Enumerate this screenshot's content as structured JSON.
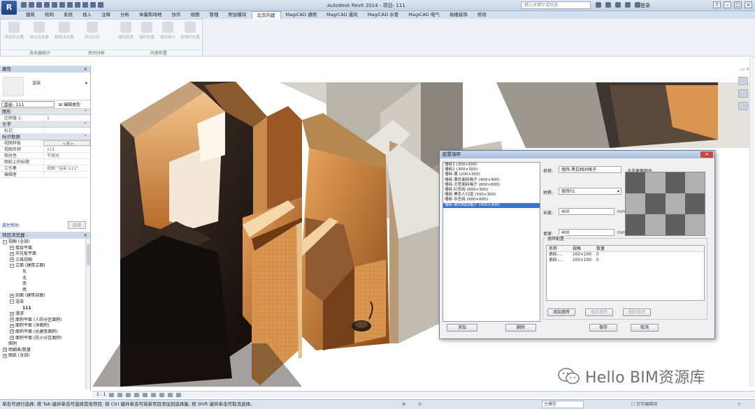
{
  "window": {
    "app_letter": "R",
    "title": "Autodesk Revit 2014 -    项目- 111",
    "search_placeholder": "键入关键字或短语",
    "login": "登录"
  },
  "ribbon": {
    "tabs": [
      "建筑",
      "结构",
      "系统",
      "插入",
      "注释",
      "分析",
      "体量和场地",
      "协作",
      "视图",
      "管理",
      "附加模块",
      "北京内建",
      "MagiCAD 通用",
      "MagiCAD 通风",
      "MagiCAD 水管",
      "MagiCAD 电气",
      "易楼装饰",
      "修改"
    ],
    "active_tab_index": 11,
    "buttons": [
      "添加洗水器",
      "弹出洗水器",
      "删除洗水器",
      "房间分析",
      "墙材厚度",
      "墙材布置",
      "墙材统计",
      "新墙材布置"
    ],
    "groups": [
      "洗水器统计",
      "房间分析",
      "内墙布置"
    ]
  },
  "properties": {
    "header": "属性",
    "type_name": "渲染",
    "selector_value": "渲染: 111",
    "edit_type": "编辑类型",
    "rows": [
      {
        "kind": "cat",
        "label": "图形",
        "toggle": "⌃"
      },
      {
        "kind": "prop",
        "key": "比例值 1:",
        "value": "1"
      },
      {
        "kind": "cat",
        "label": "文字",
        "toggle": "⌃"
      },
      {
        "kind": "prop",
        "key": "标记",
        "value": ""
      },
      {
        "kind": "cat",
        "label": "标识数据",
        "toggle": "⌃"
      },
      {
        "kind": "prop",
        "key": "视图样板",
        "value": "<无>"
      },
      {
        "kind": "prop",
        "key": "视图名称",
        "value": "111"
      },
      {
        "kind": "prop",
        "key": "相关性",
        "value": "不相关"
      },
      {
        "kind": "prop",
        "key": "图纸上的标题",
        "value": ""
      },
      {
        "kind": "prop",
        "key": "工作集",
        "value": "视图 \"渲染 111\""
      },
      {
        "kind": "prop",
        "key": "编辑者",
        "value": ""
      }
    ],
    "help_link": "属性帮助",
    "apply_label": "应用"
  },
  "project_browser": {
    "header": "项目浏览器 - ",
    "items": [
      {
        "indent": 0,
        "toggle": "−",
        "label": "视图 (全部)"
      },
      {
        "indent": 1,
        "toggle": "+",
        "label": "楼层平面"
      },
      {
        "indent": 1,
        "toggle": "+",
        "label": "天花板平面"
      },
      {
        "indent": 1,
        "toggle": "+",
        "label": "三维视图"
      },
      {
        "indent": 1,
        "toggle": "−",
        "label": "立面 (建筑立面)"
      },
      {
        "indent": 2,
        "toggle": "",
        "label": "东"
      },
      {
        "indent": 2,
        "toggle": "",
        "label": "北"
      },
      {
        "indent": 2,
        "toggle": "",
        "label": "南"
      },
      {
        "indent": 2,
        "toggle": "",
        "label": "西"
      },
      {
        "indent": 1,
        "toggle": "+",
        "label": "剖面 (建筑剖面)"
      },
      {
        "indent": 1,
        "toggle": "−",
        "label": "渲染"
      },
      {
        "indent": 2,
        "toggle": "",
        "label": "111"
      },
      {
        "indent": 1,
        "toggle": "+",
        "label": "漫游"
      },
      {
        "indent": 1,
        "toggle": "+",
        "label": "面积平面 (人防分区面积)"
      },
      {
        "indent": 1,
        "toggle": "+",
        "label": "面积平面 (净面积)"
      },
      {
        "indent": 1,
        "toggle": "+",
        "label": "面积平面 (总建筑面积)"
      },
      {
        "indent": 1,
        "toggle": "+",
        "label": "面积平面 (防火分区面积)"
      },
      {
        "indent": 0,
        "toggle": "",
        "label": "图例"
      },
      {
        "indent": 0,
        "toggle": "+",
        "label": "明细表/数量"
      },
      {
        "indent": 0,
        "toggle": "+",
        "label": "图纸 (全部)"
      }
    ]
  },
  "view_bar": {
    "scale": "1 : 1"
  },
  "dialog": {
    "title": "配置墙砖",
    "list": [
      "墙砖1 (300×600)",
      "墙砖2 (300×300)",
      "墙砖-黄 (200×300)",
      "墙砖-黄色面砖格子 (400×400)",
      "墙砖-大型面砖格子 (600×600)",
      "墙砖-红色砖 (600×300)",
      "墙砖-黑色人行道 (300×300)",
      "墙砖-灰色砖 (600×600)",
      "墙砖-黑白相间格子 (400×400)"
    ],
    "selected_index": 8,
    "name_label": "名称:",
    "name_value": "墙砖-黑白相间格子",
    "click_preview": "点击更换图片",
    "material_label": "材质:",
    "material_value": "瓷砖01",
    "length_label": "长度:",
    "length_value": "400",
    "width_label": "宽度:",
    "width_value": "400",
    "unit": "mm",
    "group_title": "瓷砖配置",
    "table_headers": [
      "名称",
      "规格",
      "数量"
    ],
    "table_rows": [
      [
        "瓷砖-…",
        "100×100",
        "0"
      ],
      [
        "瓷砖-…",
        "100×100",
        "0"
      ]
    ],
    "btn_add_tile": "添加瓷砖",
    "btn_edit_tile": "修改瓷砖",
    "btn_delete_tile": "删除瓷砖",
    "btn_add": "添加",
    "btn_delete": "删除",
    "btn_save": "保存",
    "btn_cancel": "取消",
    "preview_pattern": [
      [
        1,
        0,
        1,
        0
      ],
      [
        0,
        1,
        0,
        1
      ],
      [
        1,
        0,
        1,
        0
      ]
    ]
  },
  "watermark": "Hello BIM资源库",
  "status": {
    "text": "单击可进行选择; 按 Tab 键并单击可选择其他项目; 按 Ctrl 键并单击可将新项目添加到选择集; 按 Shift 键并单击可取消选择。",
    "filter": ":0",
    "model": "主模型",
    "active_only": "仅可编辑项"
  },
  "colors": {
    "accent": "#3b73c9",
    "ribbon_bg": "#d5e0ee",
    "wood": "#c47a34",
    "wall_gray": "#cfcac0"
  }
}
